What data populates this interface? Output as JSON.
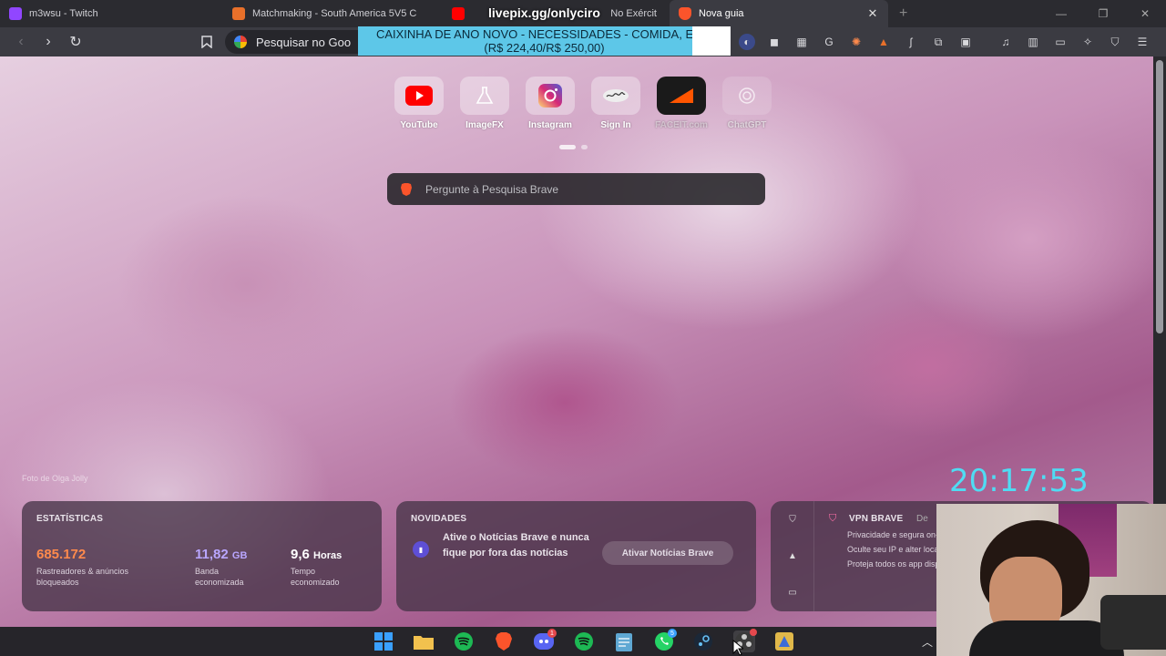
{
  "tabs": [
    {
      "title": "m3wsu - Twitch",
      "fav_color": "#9146ff",
      "active": false
    },
    {
      "title": "Matchmaking - South America 5V5 C",
      "fav_color": "#e8702a",
      "active": false
    },
    {
      "title": "No Exércit",
      "fav_color": "#ff0000",
      "active": false
    },
    {
      "title": "Nova guia",
      "fav_color": "#fb542b",
      "active": true
    }
  ],
  "toolbar": {
    "url_placeholder": "Pesquisar no Goo"
  },
  "stream": {
    "link": "livepix.gg/onlyciro",
    "donation_line1": "CAIXINHA DE ANO NOVO - NECESSIDADES - COMIDA, ETC.",
    "donation_line2": "(R$ 224,40/R$ 250,00)",
    "donation_progress": 0.898,
    "clock": "20:17:53"
  },
  "top_sites": [
    {
      "label": "YouTube",
      "icon": "youtube-icon"
    },
    {
      "label": "ImageFX",
      "icon": "flask-icon"
    },
    {
      "label": "Instagram",
      "icon": "instagram-icon"
    },
    {
      "label": "Sign In",
      "icon": "signature-icon"
    },
    {
      "label": "FACEIT.com",
      "icon": "faceit-icon"
    },
    {
      "label": "ChatGPT",
      "icon": "openai-icon"
    }
  ],
  "search": {
    "placeholder": "Pergunte à Pesquisa Brave"
  },
  "photo_credit": "Foto de Olga Jolly",
  "stats": {
    "title": "ESTATÍSTICAS",
    "blocked_value": "685.172",
    "blocked_desc_1": "Rastreadores & anúncios",
    "blocked_desc_2": "bloqueados",
    "bandwidth_value": "11,82",
    "bandwidth_unit": "GB",
    "bandwidth_desc_1": "Banda",
    "bandwidth_desc_2": "economizada",
    "time_value": "9,6",
    "time_unit": "Horas",
    "time_desc_1": "Tempo",
    "time_desc_2": "economizado"
  },
  "news": {
    "title": "NOVIDADES",
    "text": "Ative o Notícias Brave e nunca fique por fora das notícias",
    "button": "Ativar Notícias Brave"
  },
  "vpn": {
    "title": "VPN BRAVE",
    "extra": "De",
    "items": [
      "Privacidade e segura on-line",
      "Oculte seu IP e alter localização",
      "Proteja todos os app dispositivo"
    ]
  },
  "taskbar": {
    "apps": [
      {
        "name": "windows-start",
        "color": "#3aa0ff"
      },
      {
        "name": "file-explorer",
        "color": "#f2c14e"
      },
      {
        "name": "spotify",
        "color": "#1db954"
      },
      {
        "name": "brave",
        "color": "#fb542b"
      },
      {
        "name": "discord",
        "color": "#5865f2",
        "badge": "1"
      },
      {
        "name": "spotify-2",
        "color": "#1db954"
      },
      {
        "name": "notepad",
        "color": "#5fa8d3"
      },
      {
        "name": "whatsapp",
        "color": "#25d366",
        "badge": "5"
      },
      {
        "name": "steam",
        "color": "#66c0f4"
      },
      {
        "name": "obs",
        "color": "#6b6b6b"
      },
      {
        "name": "app-generic",
        "color": "#e0b84a"
      }
    ]
  },
  "colors": {
    "accent_cyan": "#4fdcf3",
    "donation_bg": "#5dc7e8",
    "stat_orange": "#ff8a4c",
    "stat_lavender": "#b9a6ff"
  }
}
